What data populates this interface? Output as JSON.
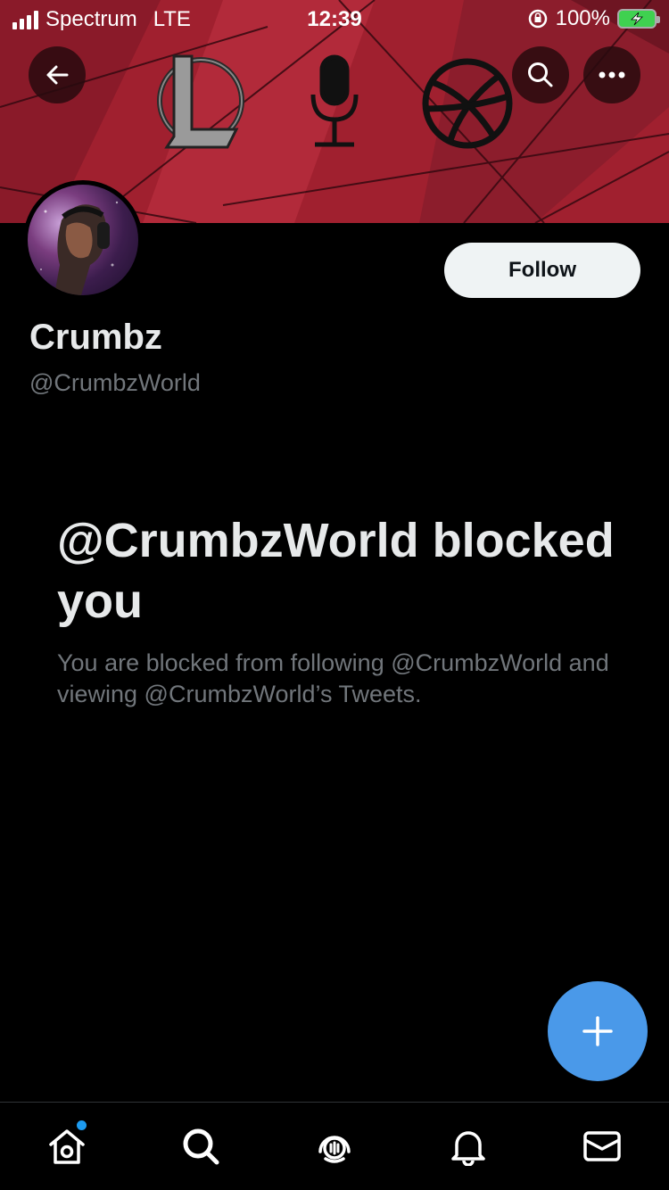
{
  "status_bar": {
    "carrier": "Spectrum",
    "network": "LTE",
    "time": "12:39",
    "battery": "100%"
  },
  "header": {
    "back_icon": "arrow-left-icon",
    "search_icon": "search-icon",
    "more_icon": "more-horizontal-icon",
    "banner_icons": [
      "league-of-legends-logo",
      "microphone-icon",
      "globe-icon"
    ]
  },
  "profile": {
    "display_name": "Crumbz",
    "handle": "@CrumbzWorld",
    "follow_label": "Follow"
  },
  "blocked": {
    "title": "@CrumbzWorld blocked you",
    "description": "You are blocked from following @CrumbzWorld and viewing @CrumbzWorld’s Tweets."
  },
  "fab": {
    "icon": "plus-icon"
  },
  "tab_bar": [
    {
      "name": "home",
      "icon": "home-icon",
      "has_notification_dot": true
    },
    {
      "name": "search",
      "icon": "search-icon"
    },
    {
      "name": "spaces",
      "icon": "spaces-icon"
    },
    {
      "name": "notifications",
      "icon": "bell-icon"
    },
    {
      "name": "messages",
      "icon": "mail-icon"
    }
  ],
  "colors": {
    "banner": "#9e1f31",
    "accent": "#4a99e9",
    "secondary_text": "#71767b",
    "button_bg": "#eff3f4"
  }
}
